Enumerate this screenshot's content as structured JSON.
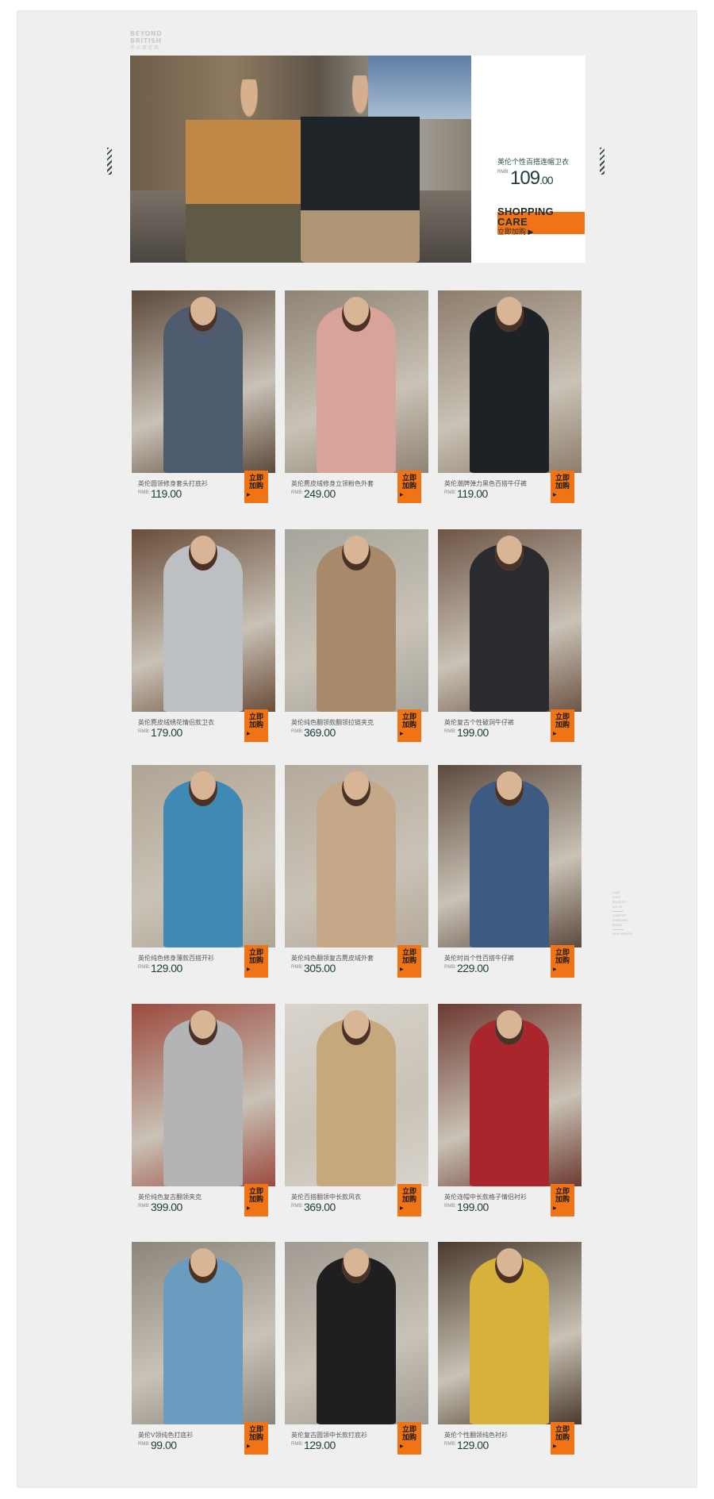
{
  "brand": {
    "line1": "BEYOND",
    "line2": "BRITISH",
    "tagline": "不止英伦风"
  },
  "hero": {
    "product_name": "英伦个性百搭连帽卫衣",
    "currency": "RMB:",
    "price_main": "109",
    "price_cents": ".00",
    "cta_title_1": "SHOPPING",
    "cta_title_2": "CARE",
    "cta_label": "立即加购 ▶"
  },
  "buy_label_1": "立即",
  "buy_label_2": "加购",
  "buy_arrow": "▶",
  "currency": "RMB:",
  "products": [
    {
      "name": "英伦圆领修身套头打底衫",
      "price": "119.00",
      "bg": "#5c4a3c",
      "fig": "#4e5b6e"
    },
    {
      "name": "英伦麂皮绒修身立领粉色外套",
      "price": "249.00",
      "bg": "#8f8474",
      "fig": "#d9a39a"
    },
    {
      "name": "英伦潮牌弹力黑色百搭牛仔裤",
      "price": "119.00",
      "bg": "#8d7d6c",
      "fig": "#1e2226"
    },
    {
      "name": "英伦麂皮绒绣花情侣款卫衣",
      "price": "179.00",
      "bg": "#6a4d3a",
      "fig": "#bcc0c3"
    },
    {
      "name": "英伦纯色翻领款翻领拉链夹克",
      "price": "369.00",
      "bg": "#a6a59c",
      "fig": "#a8896a"
    },
    {
      "name": "英伦复古个性破洞牛仔裤",
      "price": "199.00",
      "bg": "#6e5546",
      "fig": "#2a2b2e"
    },
    {
      "name": "英伦纯色修身薄款百搭开衫",
      "price": "129.00",
      "bg": "#b0a594",
      "fig": "#3f89b5"
    },
    {
      "name": "英伦纯色翻领复古麂皮绒外套",
      "price": "305.00",
      "bg": "#b4aa9c",
      "fig": "#c4a888"
    },
    {
      "name": "英伦时尚个性百搭牛仔裤",
      "price": "229.00",
      "bg": "#5d4a3f",
      "fig": "#3c5a82"
    },
    {
      "name": "英伦纯色复古翻领夹克",
      "price": "399.00",
      "bg": "#9c4a3e",
      "fig": "#b2b4b6"
    },
    {
      "name": "英伦百搭翻领中长款风衣",
      "price": "369.00",
      "bg": "#d8d4cc",
      "fig": "#c6a87c"
    },
    {
      "name": "英伦连帽中长款格子情侣衬衫",
      "price": "199.00",
      "bg": "#6d3a30",
      "fig": "#a8262c"
    },
    {
      "name": "英伦V领纯色打底衫",
      "price": "99.00",
      "bg": "#8c857b",
      "fig": "#6a9cc0"
    },
    {
      "name": "英伦复古圆领中长款打底衫",
      "price": "129.00",
      "bg": "#a09a92",
      "fig": "#1f1f21"
    },
    {
      "name": "英伦个性翻领纯色衬衫",
      "price": "129.00",
      "bg": "#4a3a2e",
      "fig": "#d7b13a"
    }
  ],
  "sidenote": [
    "LOOK",
    "SHOP",
    "BOUQUET COLOR",
    "COMFORT",
    "STANDARD",
    "BRAND",
    "NEW FASHION"
  ]
}
